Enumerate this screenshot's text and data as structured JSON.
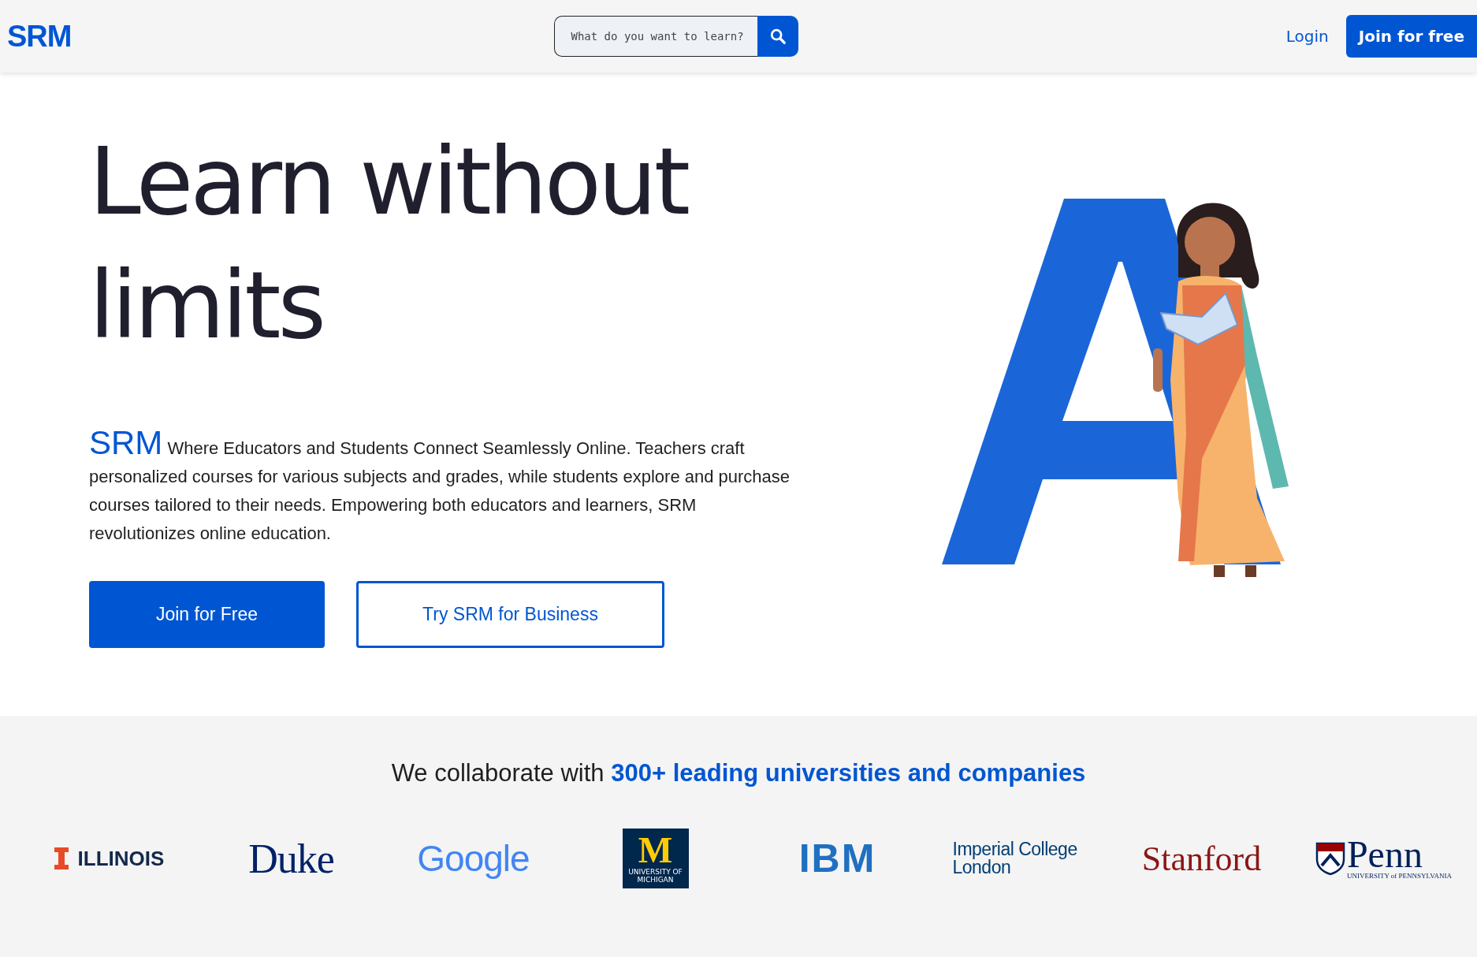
{
  "header": {
    "logo": "SRM",
    "search": {
      "placeholder": "What do you want to learn?"
    },
    "login": "Login",
    "join": "Join for free"
  },
  "hero": {
    "title": "Learn without limits",
    "brand": "SRM",
    "description": "Where Educators and Students Connect Seamlessly Online. Teachers craft personalized courses for various subjects and grades, while students explore and purchase courses tailored to their needs. Empowering both educators and learners, SRM revolutionizes online education.",
    "buttons": [
      {
        "label": "Join for Free",
        "kind": "primary"
      },
      {
        "label": "Try SRM for Business",
        "kind": "outline"
      }
    ]
  },
  "partners": {
    "heading": "We collaborate with **300+ leading universities and companies**",
    "logos": [
      {
        "kind": "illinois",
        "text": "ILLINOIS"
      },
      {
        "kind": "duke",
        "text": "Duke"
      },
      {
        "kind": "google",
        "text": "Google"
      },
      {
        "kind": "michigan",
        "text": "M",
        "subtext": "UNIVERSITY OF MICHIGAN"
      },
      {
        "kind": "ibm",
        "text": "IBM"
      },
      {
        "kind": "imperial",
        "text": "Imperial College London"
      },
      {
        "kind": "stanford",
        "text": "Stanford"
      },
      {
        "kind": "penn",
        "text": "Penn",
        "subtext": "UNIVERSITY of PENNSYLVANIA"
      }
    ]
  }
}
